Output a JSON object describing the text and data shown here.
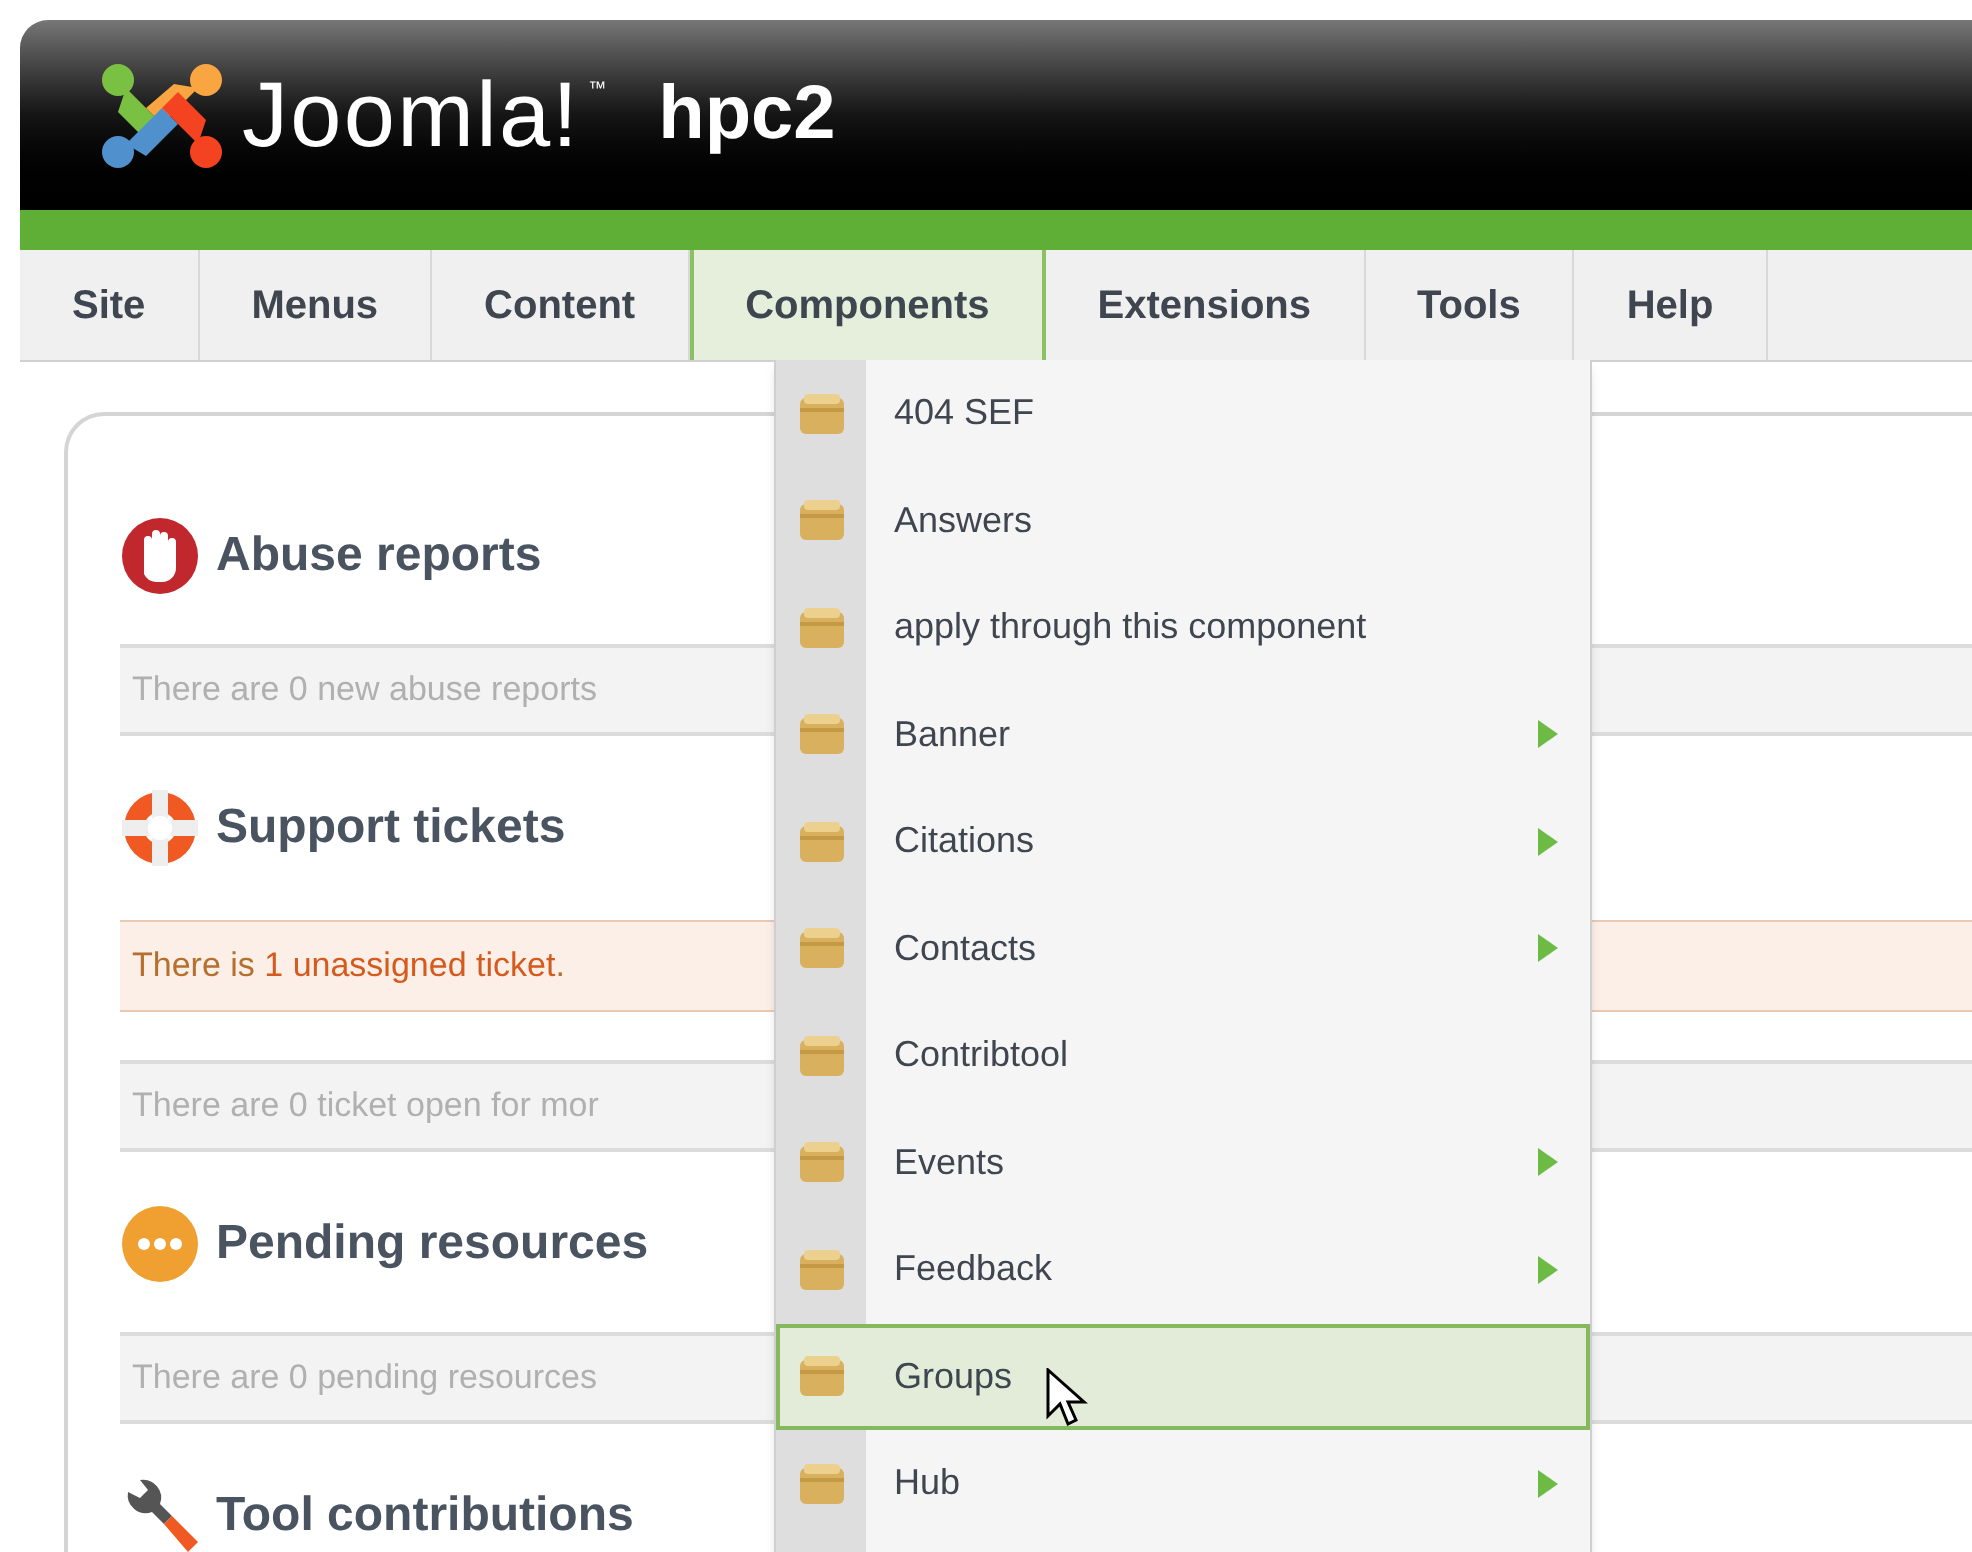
{
  "header": {
    "brand": "Joomla!",
    "trademark": "™",
    "site_name": "hpc2"
  },
  "menu": [
    {
      "label": "Site",
      "selected": false
    },
    {
      "label": "Menus",
      "selected": false
    },
    {
      "label": "Content",
      "selected": false
    },
    {
      "label": "Components",
      "selected": true
    },
    {
      "label": "Extensions",
      "selected": false
    },
    {
      "label": "Tools",
      "selected": false
    },
    {
      "label": "Help",
      "selected": false
    }
  ],
  "sections": [
    {
      "kind": "abuse",
      "title": "Abuse reports",
      "notices": [
        {
          "kind": "plain",
          "text": "There are 0 new abuse reports"
        }
      ]
    },
    {
      "kind": "support",
      "title": "Support tickets",
      "notices": [
        {
          "kind": "alert",
          "prefix": "There is ",
          "link": "1 unassigned ticket",
          "suffix": "."
        },
        {
          "kind": "plain",
          "text": "There are 0 ticket open for mor"
        }
      ]
    },
    {
      "kind": "pending",
      "title": "Pending resources",
      "notices": [
        {
          "kind": "plain",
          "text": "There are 0 pending resources"
        }
      ]
    },
    {
      "kind": "tools",
      "title": "Tool contributions"
    }
  ],
  "dropdown": [
    {
      "label": "404 SEF",
      "submenu": false,
      "selected": false
    },
    {
      "label": "Answers",
      "submenu": false,
      "selected": false
    },
    {
      "label": "apply through this component",
      "submenu": false,
      "selected": false
    },
    {
      "label": "Banner",
      "submenu": true,
      "selected": false
    },
    {
      "label": "Citations",
      "submenu": true,
      "selected": false
    },
    {
      "label": "Contacts",
      "submenu": true,
      "selected": false
    },
    {
      "label": "Contribtool",
      "submenu": false,
      "selected": false
    },
    {
      "label": "Events",
      "submenu": true,
      "selected": false
    },
    {
      "label": "Feedback",
      "submenu": true,
      "selected": false
    },
    {
      "label": "Groups",
      "submenu": false,
      "selected": true
    },
    {
      "label": "Hub",
      "submenu": true,
      "selected": false
    }
  ]
}
